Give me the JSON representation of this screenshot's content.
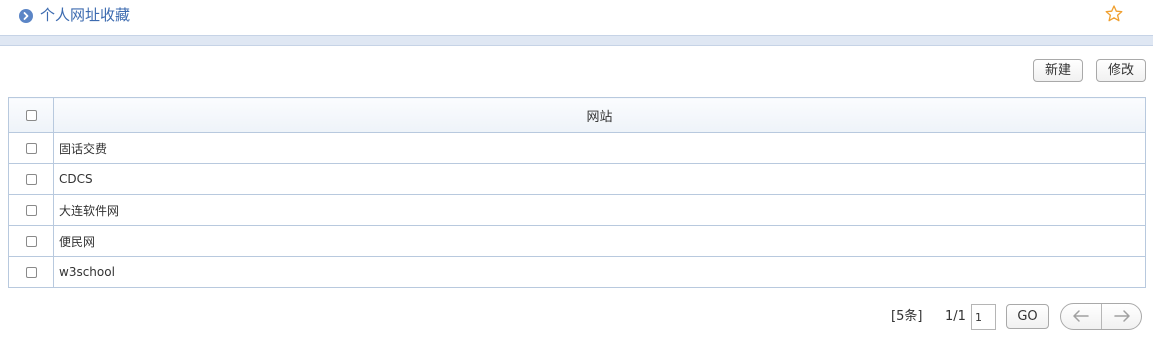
{
  "header": {
    "title": "个人网址收藏",
    "bullet_icon": "chevron-right-circle-icon",
    "favorite_icon": "star-outline-icon",
    "accent_color": "#3d6bb0",
    "star_color": "#f0a030"
  },
  "toolbar": {
    "new_label": "新建",
    "edit_label": "修改"
  },
  "table": {
    "header": "网站",
    "rows": [
      {
        "site": "固话交费"
      },
      {
        "site": "CDCS"
      },
      {
        "site": "大连软件网"
      },
      {
        "site": "便民网"
      },
      {
        "site": "w3school"
      }
    ]
  },
  "pager": {
    "count": "[5条]",
    "pages": "1/1",
    "page_value": "1",
    "go_label": "GO",
    "prev_icon": "arrow-left-icon",
    "next_icon": "arrow-right-icon"
  }
}
